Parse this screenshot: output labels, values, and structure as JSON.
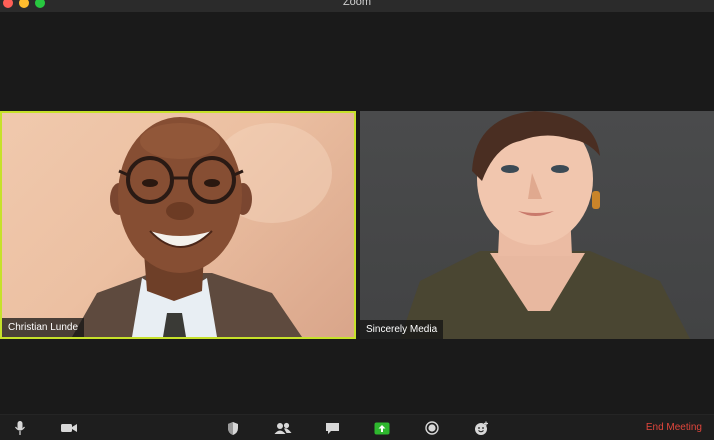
{
  "window": {
    "title": "Zoom"
  },
  "participants": [
    {
      "name": "Christian Lunde",
      "active_speaker": true
    },
    {
      "name": "Sincerely Media",
      "active_speaker": false
    }
  ],
  "toolbar": {
    "icons": [
      "microphone-icon",
      "video-camera-icon",
      "security-shield-icon",
      "participants-icon",
      "chat-icon",
      "share-screen-icon",
      "record-icon",
      "reactions-icon"
    ],
    "end_label": "End Meeting"
  },
  "colors": {
    "active_speaker_border": "#c6e12a",
    "share_screen": "#2eb82e",
    "end_meeting": "#e0463c"
  }
}
